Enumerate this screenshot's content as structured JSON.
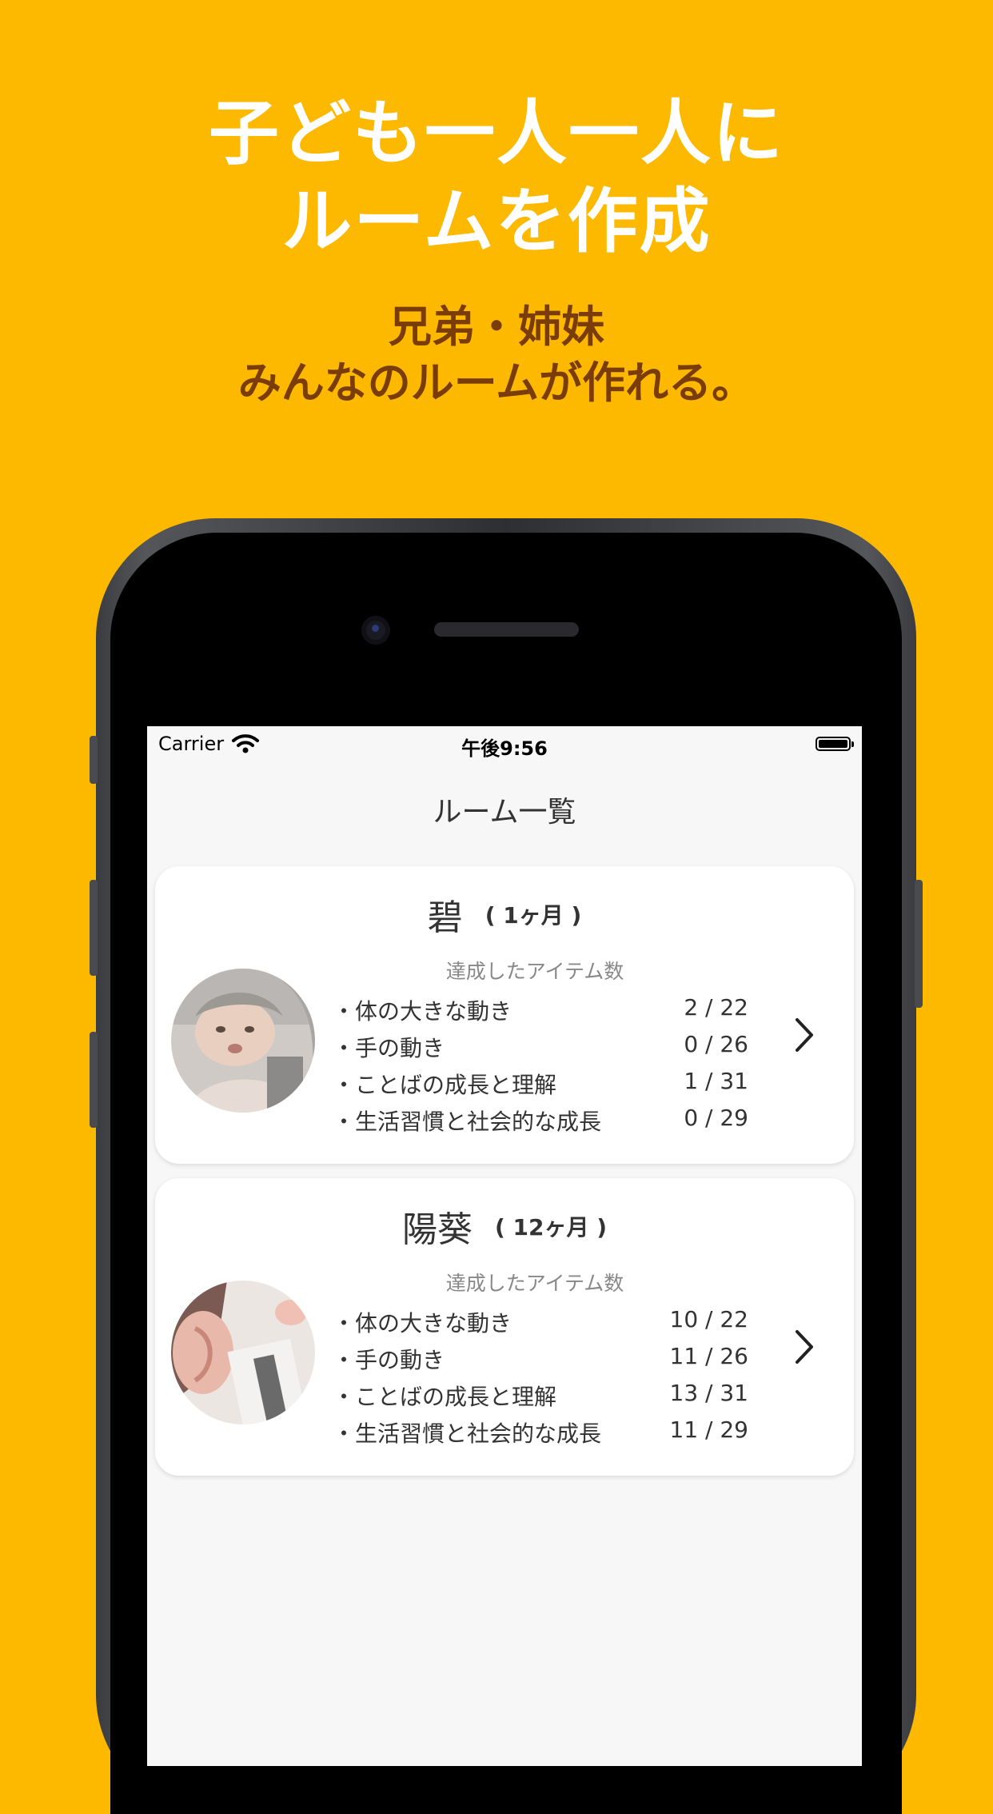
{
  "headline": {
    "line1": "子ども一人一人に",
    "line2": "ルームを作成"
  },
  "subline": {
    "line1": "兄弟・姉妹",
    "line2": "みんなのルームが作れる。"
  },
  "status_bar": {
    "carrier": "Carrier",
    "time": "午後9:56"
  },
  "nav": {
    "title": "ルーム一覧"
  },
  "rooms": [
    {
      "name": "碧",
      "age": "( 1ヶ月 )",
      "achieved_label": "達成したアイテム数",
      "items": [
        {
          "label": "・体の大きな動き",
          "value": "2 / 22"
        },
        {
          "label": "・手の動き",
          "value": "0 / 26"
        },
        {
          "label": "・ことばの成長と理解",
          "value": "1 / 31"
        },
        {
          "label": "・生活習慣と社会的な成長",
          "value": "0 / 29"
        }
      ]
    },
    {
      "name": "陽葵",
      "age": "( 12ヶ月 )",
      "achieved_label": "達成したアイテム数",
      "items": [
        {
          "label": "・体の大きな動き",
          "value": "10 / 22"
        },
        {
          "label": "・手の動き",
          "value": "11 / 26"
        },
        {
          "label": "・ことばの成長と理解",
          "value": "13 / 31"
        },
        {
          "label": "・生活習慣と社会的な成長",
          "value": "11 / 29"
        }
      ]
    }
  ],
  "colors": {
    "background": "#FDB900",
    "headline": "#FFFFFF",
    "subline": "#7A3D0A"
  },
  "icons": {
    "wifi": "wifi-icon",
    "battery": "battery-icon",
    "chevron": "chevron-right-icon"
  }
}
